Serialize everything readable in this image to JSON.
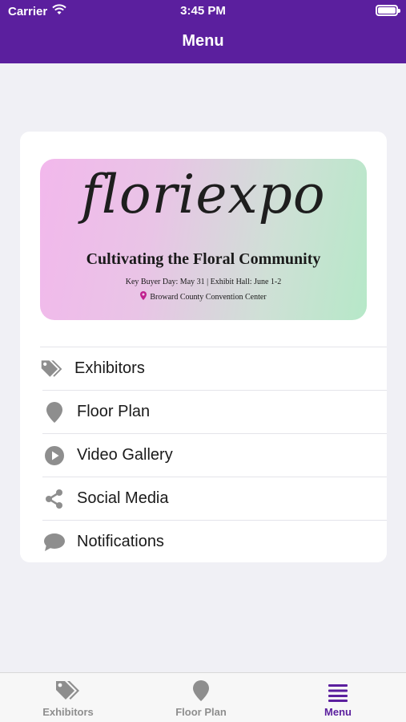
{
  "status": {
    "carrier": "Carrier",
    "time": "3:45 PM"
  },
  "header": {
    "title": "Menu"
  },
  "banner": {
    "logo_text": "floriexpo",
    "tagline": "Cultivating the Floral Community",
    "dates": "Key Buyer Day: May 31  |  Exhibit Hall: June 1-2",
    "venue": "Broward County Convention Center"
  },
  "menu": {
    "items": [
      {
        "label": "Exhibitors",
        "icon": "tags-icon"
      },
      {
        "label": "Floor Plan",
        "icon": "map-pin-icon"
      },
      {
        "label": "Video Gallery",
        "icon": "play-circle-icon"
      },
      {
        "label": "Social Media",
        "icon": "share-icon"
      },
      {
        "label": "Notifications",
        "icon": "chat-bubble-icon"
      }
    ]
  },
  "tabbar": {
    "tabs": [
      {
        "label": "Exhibitors",
        "icon": "tags-icon",
        "active": false
      },
      {
        "label": "Floor Plan",
        "icon": "map-pin-icon",
        "active": false
      },
      {
        "label": "Menu",
        "icon": "hamburger-menu-icon",
        "active": true
      }
    ]
  },
  "colors": {
    "brand_purple": "#5b1f9e",
    "icon_gray": "#8e8e8e",
    "venue_pin": "#c0208f"
  }
}
